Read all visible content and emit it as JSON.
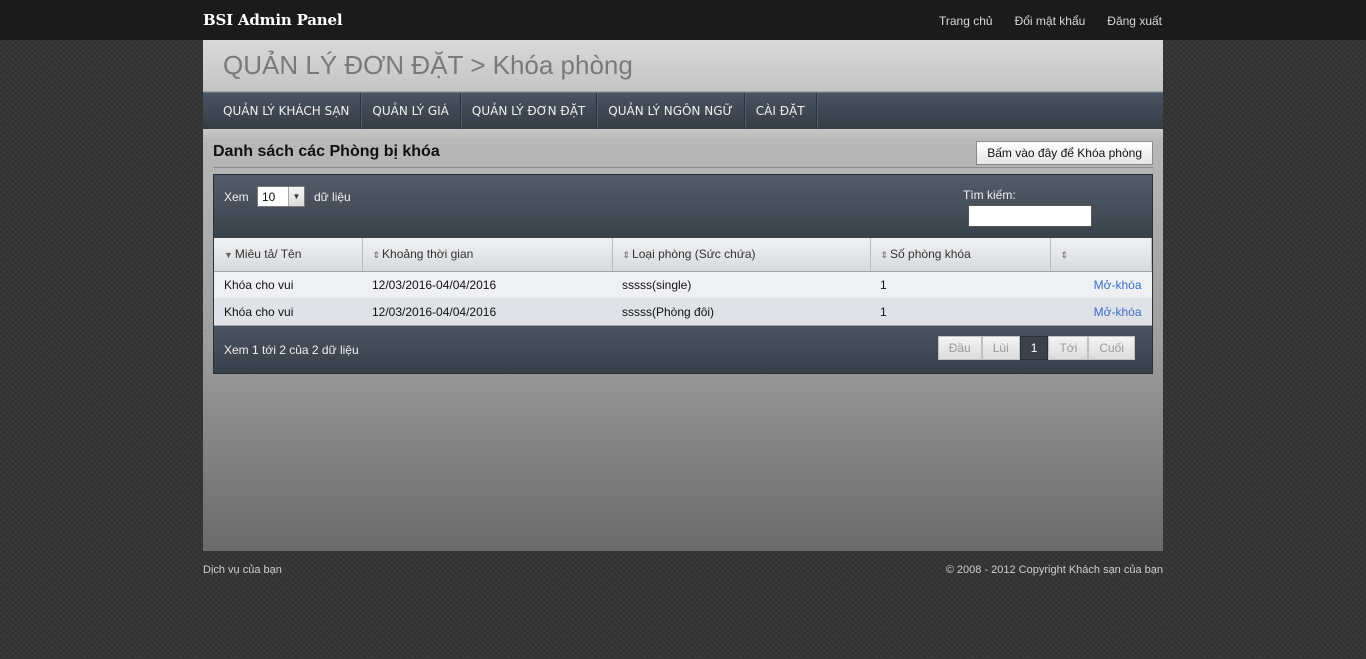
{
  "topbar": {
    "brand": "BSI Admin Panel",
    "links": [
      "Trang chủ",
      "Đổi mật khẩu",
      "Đăng xuất"
    ]
  },
  "header": {
    "title": "QUẢN LÝ ĐƠN ĐẶT > Khóa phòng"
  },
  "mainnav": [
    "QUẢN LÝ KHÁCH SẠN",
    "QUẢN LÝ GIÁ",
    "QUẢN LÝ ĐƠN ĐẶT",
    "QUẢN LÝ NGÔN NGỮ",
    "CÀI ĐẶT"
  ],
  "section": {
    "title": "Danh sách các Phòng bị khóa",
    "lock_button": "Bấm vào đây để Khóa phòng"
  },
  "grid": {
    "show_label": "Xem",
    "page_size": "10",
    "records_label": "dữ liệu",
    "search_label": "Tìm kiếm:",
    "search_value": "",
    "columns": [
      "Miêu tả/ Tên",
      "Khoảng thời gian",
      "Loại phòng (Sức chứa)",
      "Số phòng khóa",
      ""
    ],
    "rows": [
      [
        "Khóa cho vui",
        "12/03/2016-04/04/2016",
        "sssss(single)",
        "1",
        "Mở-khóa"
      ],
      [
        "Khóa cho vui",
        "12/03/2016-04/04/2016",
        "sssss(Phòng đôi)",
        "1",
        "Mở-khóa"
      ]
    ],
    "info": "Xem 1 tới 2 của 2 dữ liệu",
    "pager": {
      "first": "Đầu",
      "prev": "Lùi",
      "current": "1",
      "next": "Tới",
      "last": "Cuối"
    }
  },
  "footer": {
    "left": "Dịch vụ của bạn",
    "right": "© 2008 - 2012 Copyright Khách sạn của bạn"
  }
}
